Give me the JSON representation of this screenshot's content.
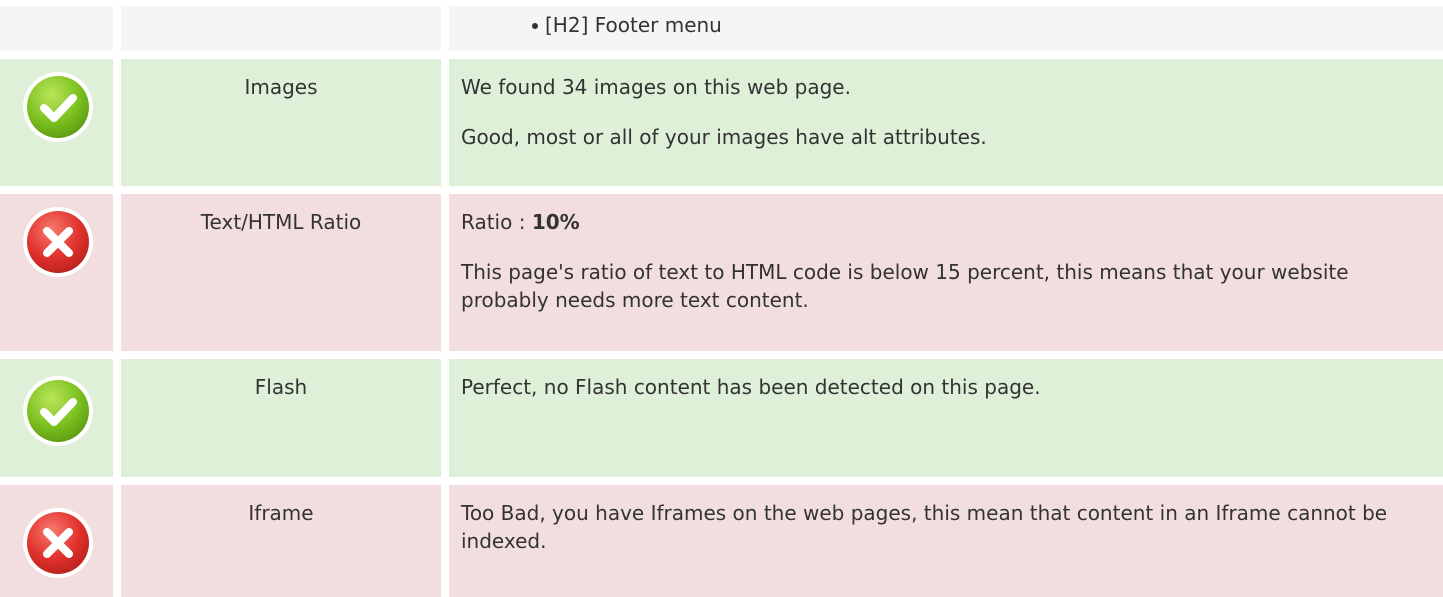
{
  "top_row": {
    "list_items": [
      "[H2] Footer menu"
    ]
  },
  "rows": [
    {
      "status": "pass",
      "icon": "check-icon",
      "label": "Images",
      "lines": [
        "We found 34 images on this web page.",
        "Good, most or all of your images have alt attributes."
      ]
    },
    {
      "status": "fail",
      "icon": "cross-icon",
      "label": "Text/HTML Ratio",
      "ratio_label": "Ratio : ",
      "ratio_value": "10%",
      "lines": [
        "This page's ratio of text to HTML code is below 15 percent, this means that your website probably needs more text content."
      ]
    },
    {
      "status": "pass",
      "icon": "check-icon",
      "label": "Flash",
      "lines": [
        "Perfect, no Flash content has been detected on this page."
      ]
    },
    {
      "status": "fail",
      "icon": "cross-icon",
      "label": "Iframe",
      "lines": [
        "Too Bad, you have Iframes on the web pages, this mean that content in an Iframe cannot be indexed."
      ]
    }
  ],
  "colors": {
    "pass_bg": "#dff0d8",
    "fail_bg": "#f2dede",
    "neutral_bg": "#f5f5f5",
    "pass_icon": "#7cc020",
    "fail_icon": "#e0312c"
  }
}
